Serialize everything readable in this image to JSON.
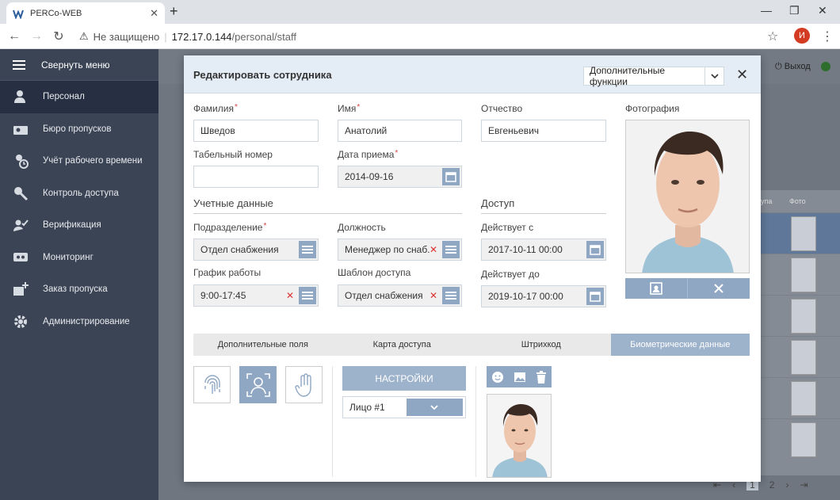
{
  "browser": {
    "tab_title": "PERCo-WEB",
    "insecure_label": "Не защищено",
    "url_host": "172.17.0.144",
    "url_path": "/personal/staff",
    "profile_initial": "И"
  },
  "sidebar": {
    "collapse_label": "Свернуть меню",
    "items": [
      {
        "label": "Персонал",
        "icon": "person-icon",
        "active": true
      },
      {
        "label": "Бюро пропусков",
        "icon": "badge-icon"
      },
      {
        "label": "Учёт рабочего времени",
        "icon": "time-tracking-icon"
      },
      {
        "label": "Контроль доступа",
        "icon": "key-icon"
      },
      {
        "label": "Верификация",
        "icon": "verification-icon"
      },
      {
        "label": "Мониторинг",
        "icon": "monitor-icon"
      },
      {
        "label": "Заказ пропуска",
        "icon": "order-pass-icon"
      },
      {
        "label": "Администрирование",
        "icon": "gear-icon"
      }
    ]
  },
  "background": {
    "exit_label": "Выход",
    "col_photo": "Фото",
    "col_partial": "упа",
    "pager": [
      "1",
      "2"
    ]
  },
  "modal": {
    "title": "Редактировать сотрудника",
    "extra_functions": "Дополнительные функции",
    "fields": {
      "last_name_label": "Фамилия",
      "last_name": "Шведов",
      "first_name_label": "Имя",
      "first_name": "Анатолий",
      "patronymic_label": "Отчество",
      "patronymic": "Евгеньевич",
      "tab_number_label": "Табельный номер",
      "tab_number": "",
      "hire_date_label": "Дата приема",
      "hire_date": "2014-09-16",
      "photo_label": "Фотография",
      "credentials_section": "Учетные данные",
      "access_section": "Доступ",
      "division_label": "Подразделение",
      "division": "Отдел снабжения",
      "position_label": "Должность",
      "position": "Менеджер по снаб...",
      "valid_from_label": "Действует с",
      "valid_from": "2017-10-11 00:00",
      "schedule_label": "График работы",
      "schedule": "9:00-17:45",
      "access_template_label": "Шаблон доступа",
      "access_template": "Отдел снабжения",
      "valid_to_label": "Действует до",
      "valid_to": "2019-10-17 00:00"
    },
    "tabs": [
      {
        "label": "Дополнительные поля"
      },
      {
        "label": "Карта доступа"
      },
      {
        "label": "Штрихкод"
      },
      {
        "label": "Биометрические данные",
        "active": true
      }
    ],
    "biometrics": {
      "settings_label": "НАСТРОЙКИ",
      "face_select": "Лицо #1"
    }
  }
}
